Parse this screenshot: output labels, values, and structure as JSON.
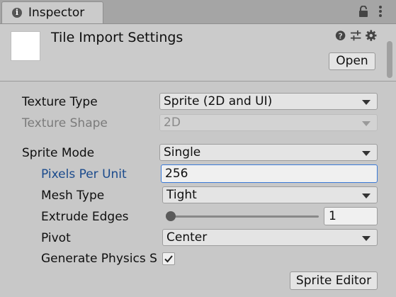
{
  "tab": {
    "title": "Inspector",
    "icon": "info-icon"
  },
  "tab_actions": {
    "lock_icon": "lock-icon",
    "menu_icon": "kebab-menu-icon"
  },
  "header": {
    "title": "Tile Import Settings",
    "open_label": "Open",
    "icons": [
      "help-icon",
      "preset-sliders-icon",
      "settings-gear-icon"
    ]
  },
  "fields": {
    "texture_type": {
      "label": "Texture Type",
      "value": "Sprite (2D and UI)"
    },
    "texture_shape": {
      "label": "Texture Shape",
      "value": "2D"
    },
    "sprite_mode": {
      "label": "Sprite Mode",
      "value": "Single"
    },
    "pixels_per_unit": {
      "label": "Pixels Per Unit",
      "value": "256"
    },
    "mesh_type": {
      "label": "Mesh Type",
      "value": "Tight"
    },
    "extrude_edges": {
      "label": "Extrude Edges",
      "value": "1",
      "slider_fraction": 0.0
    },
    "pivot": {
      "label": "Pivot",
      "value": "Center"
    },
    "generate_physics": {
      "label": "Generate Physics Shape",
      "checked": true
    }
  },
  "sprite_editor_label": "Sprite Editor",
  "colors": {
    "modified_label": "#1a4a8c",
    "focus_border": "#3a79d7"
  }
}
